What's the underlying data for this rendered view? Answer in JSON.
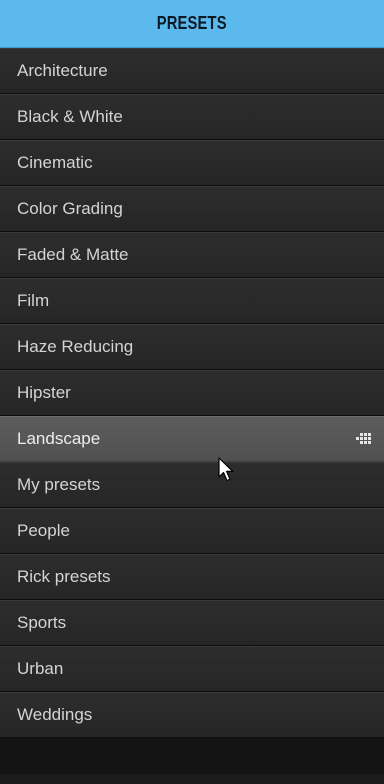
{
  "header": {
    "title": "PRESETS"
  },
  "presets": [
    {
      "label": "Architecture"
    },
    {
      "label": "Black & White"
    },
    {
      "label": "Cinematic"
    },
    {
      "label": "Color Grading"
    },
    {
      "label": "Faded & Matte"
    },
    {
      "label": "Film"
    },
    {
      "label": "Haze Reducing"
    },
    {
      "label": "Hipster"
    },
    {
      "label": "Landscape",
      "selected": true
    },
    {
      "label": "My presets"
    },
    {
      "label": "People"
    },
    {
      "label": "Rick presets"
    },
    {
      "label": "Sports"
    },
    {
      "label": "Urban"
    },
    {
      "label": "Weddings"
    }
  ],
  "icons": {
    "grid": "grid-view-icon",
    "cursor": "mouse-pointer-icon"
  },
  "colors": {
    "header_bg": "#5bb9ee",
    "item_bg": "#2a2a2b",
    "selected_bg": "#575758",
    "text": "#d4d4d4"
  }
}
